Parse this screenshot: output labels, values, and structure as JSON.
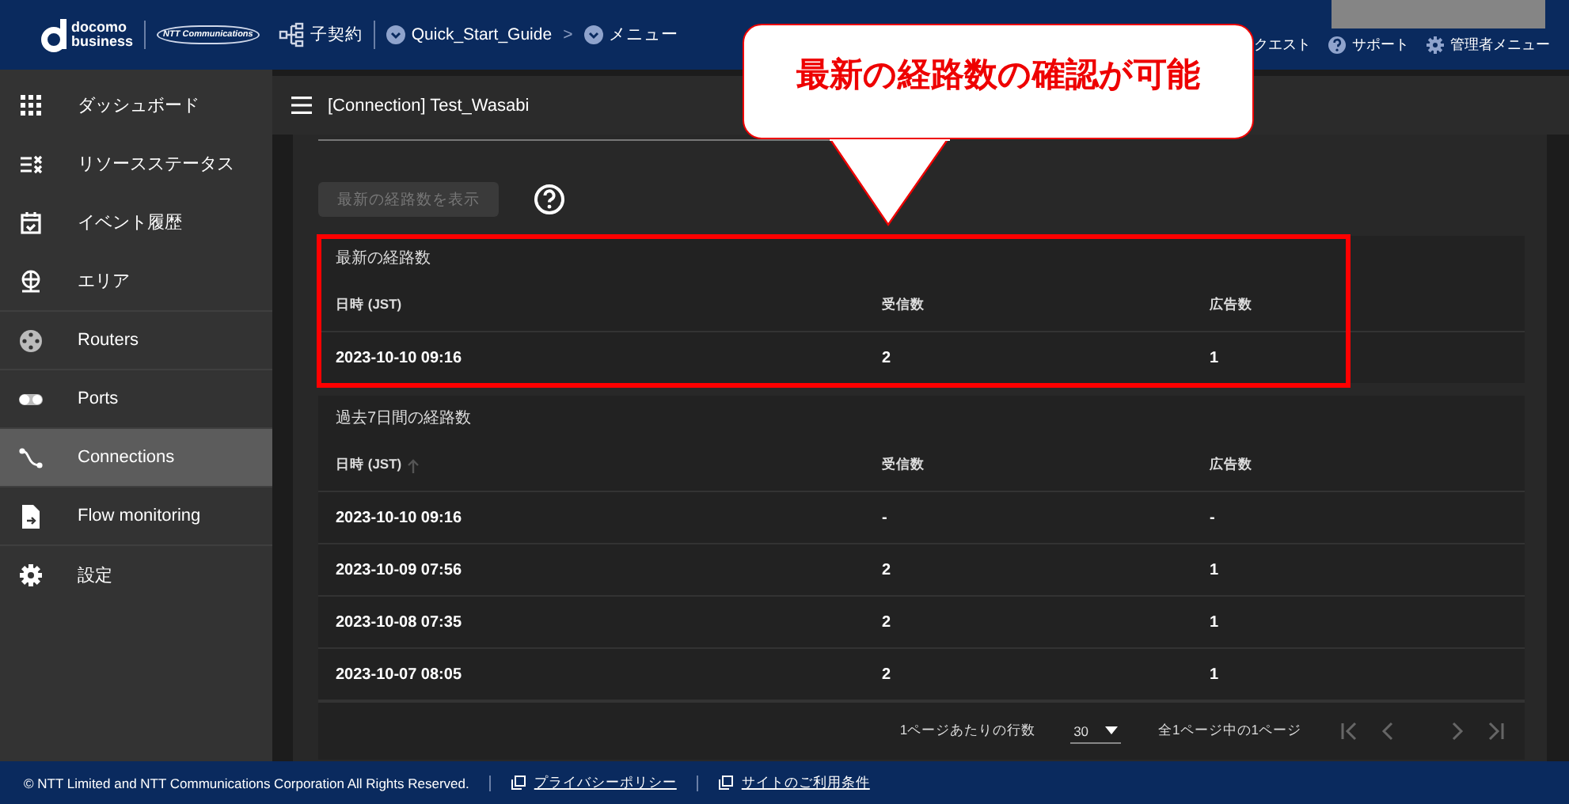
{
  "header": {
    "logo_top": "docomo",
    "logo_bottom": "business",
    "partner_logo": "NTT Communications",
    "contract": "子契約",
    "breadcrumb_separator": ">",
    "breadcrumbs": [
      {
        "label": "Quick_Start_Guide"
      },
      {
        "label": "メニュー"
      }
    ],
    "links": [
      {
        "label": "クエスト",
        "kind": "plain"
      },
      {
        "label": "サポート",
        "kind": "help"
      },
      {
        "label": "管理者メニュー",
        "kind": "gear"
      }
    ]
  },
  "sidebar": {
    "items": [
      {
        "label": "ダッシュボード",
        "kind": "grid",
        "selected": false
      },
      {
        "label": "リソースステータス",
        "kind": "checklist",
        "selected": false
      },
      {
        "label": "イベント履歴",
        "kind": "calendar",
        "selected": false
      },
      {
        "label": "エリア",
        "kind": "globe",
        "selected": false
      },
      {
        "label": "Routers",
        "kind": "router",
        "selected": false
      },
      {
        "label": "Ports",
        "kind": "toggle",
        "selected": false
      },
      {
        "label": "Connections",
        "kind": "route",
        "selected": true
      },
      {
        "label": "Flow monitoring",
        "kind": "file",
        "selected": false
      },
      {
        "label": "設定",
        "kind": "gear",
        "selected": false
      }
    ]
  },
  "page": {
    "title": "[Connection] Test_Wasabi"
  },
  "show_button": {
    "label": "最新の経路数を表示",
    "disabled": true
  },
  "latest": {
    "title": "最新の経路数",
    "columns": [
      {
        "label": "日時 (JST)",
        "sorted": false
      },
      {
        "label": "受信数",
        "sorted": false
      },
      {
        "label": "広告数",
        "sorted": false
      }
    ],
    "rows": [
      [
        "2023-10-10 09:16",
        "2",
        "1"
      ]
    ]
  },
  "history": {
    "title": "過去7日間の経路数",
    "columns": [
      {
        "label": "日時 (JST)",
        "sorted": true
      },
      {
        "label": "受信数",
        "sorted": false
      },
      {
        "label": "広告数",
        "sorted": false
      }
    ],
    "rows": [
      [
        "2023-10-10 09:16",
        "-",
        "-"
      ],
      [
        "2023-10-09 07:56",
        "2",
        "1"
      ],
      [
        "2023-10-08 07:35",
        "2",
        "1"
      ],
      [
        "2023-10-07 08:05",
        "2",
        "1"
      ]
    ],
    "pagination": {
      "rows_label": "1ページあたりの行数",
      "rows_per_page": "30",
      "range": "全1ページ中の1ページ"
    }
  },
  "footer": {
    "copyright": "© NTT Limited and NTT Communications Corporation All Rights Reserved.",
    "links": [
      "プライバシーポリシー",
      "サイトのご利用条件"
    ]
  },
  "annotation": {
    "callout": "最新の経路数の確認が可能"
  }
}
